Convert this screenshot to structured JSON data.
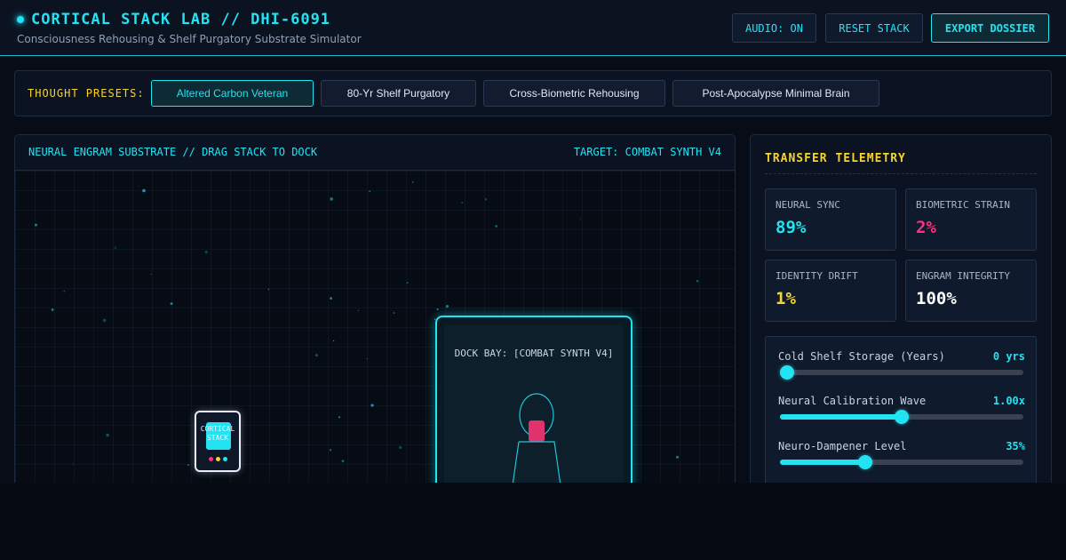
{
  "header": {
    "title": "CORTICAL STACK LAB // DHI-6091",
    "subtitle": "Consciousness Rehousing & Shelf Purgatory Substrate Simulator",
    "buttons": {
      "audio": "AUDIO: ON",
      "reset": "RESET STACK",
      "export": "EXPORT DOSSIER"
    }
  },
  "presets": {
    "label": "THOUGHT PRESETS:",
    "items": [
      {
        "label": "Altered Carbon Veteran",
        "active": true
      },
      {
        "label": "80-Yr Shelf Purgatory",
        "active": false
      },
      {
        "label": "Cross-Biometric Rehousing",
        "active": false
      },
      {
        "label": "Post-Apocalypse Minimal Brain",
        "active": false
      }
    ]
  },
  "substrate": {
    "title": "NEURAL ENGRAM SUBSTRATE // DRAG STACK TO DOCK",
    "target": "TARGET: COMBAT SYNTH V4",
    "stack_label_line1": "CORTICAL",
    "stack_label_line2": "STACK",
    "dock_label": "DOCK BAY: [COMBAT SYNTH V4]"
  },
  "telemetry": {
    "title": "TRANSFER TELEMETRY",
    "metrics": [
      {
        "label": "NEURAL SYNC",
        "value": "89%",
        "color": "#22e3f2"
      },
      {
        "label": "BIOMETRIC STRAIN",
        "value": "2%",
        "color": "#ff2e7e"
      },
      {
        "label": "IDENTITY DRIFT",
        "value": "1%",
        "color": "#f6d32d"
      },
      {
        "label": "ENGRAM INTEGRITY",
        "value": "100%",
        "color": "#ffffff"
      }
    ],
    "sliders": [
      {
        "label": "Cold Shelf Storage (Years)",
        "value_text": "0 yrs",
        "fraction": 0.0
      },
      {
        "label": "Neural Calibration Wave",
        "value_text": "1.00x",
        "fraction": 0.5
      },
      {
        "label": "Neuro-Dampener Level",
        "value_text": "35%",
        "fraction": 0.35
      }
    ]
  },
  "colors": {
    "accent": "#22e3f2",
    "warning": "#f6d32d",
    "danger": "#ff2e7e",
    "stack_dots": [
      "#ff2e7e",
      "#f6d32d",
      "#22e3f2"
    ]
  }
}
